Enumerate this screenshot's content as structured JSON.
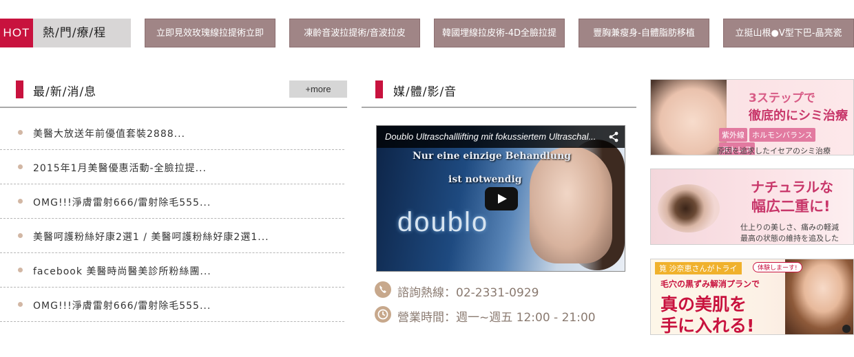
{
  "hot": {
    "label": "HOT",
    "title": "熱/門/療/程",
    "items": [
      "立即見效玫瑰線拉提術立即",
      "凍齡音波拉提術/音波拉皮",
      "韓國埋線拉皮術-4D全臉拉提",
      "豐胸兼瘦身-自體脂肪移植",
      "立挺山根●V型下巴-晶亮瓷"
    ]
  },
  "news": {
    "title": "最/新/消/息",
    "more_label": "+more",
    "items": [
      "美醫大放送年前優值套裝2888...",
      "2015年1月美醫優惠活動-全臉拉提...",
      "OMG!!!淨膚雷射666/雷射除毛555...",
      "美醫呵護粉絲好康2選1 / 美醫呵護粉絲好康2選1...",
      "facebook 美醫時尚醫美診所粉絲團...",
      "OMG!!!淨膚雷射666/雷射除毛555..."
    ]
  },
  "media": {
    "title": "媒/體/影/音",
    "video": {
      "title": "Doublo Ultraschalllifting mit fokussiertem Ultraschal...",
      "line1": "Nur eine einzige Behandlung",
      "line2": "ist notwendig",
      "brand": "doublo"
    },
    "phone": "諮詢熱線：02-2331-0929",
    "hours": "營業時間：週一~週五 12:00 - 21:00"
  },
  "banners": {
    "b1": {
      "head": "3ステップで",
      "head2": "徹底的にシミ治療",
      "tags": [
        "紫外線",
        "ホルモンバランス",
        "ストレス"
      ],
      "foot": "原因を追求したイセアのシミ治療"
    },
    "b2": {
      "head": "ナチュラルな",
      "head2": "幅広二重に!",
      "sub": "仕上りの美しさ、痛みの軽減",
      "sub2": "最高の状態の維持を追及した"
    },
    "b3": {
      "name": "筧 沙奈恵さんがトライ",
      "badge": "体験しまーす!",
      "sub": "毛穴の黒ずみ解消プランで",
      "big1": "真の美肌を",
      "big2": "手に入れる!"
    }
  },
  "colors": {
    "accent": "#c8123e",
    "hot_button": "#a08586",
    "contact": "#8a7a70"
  }
}
